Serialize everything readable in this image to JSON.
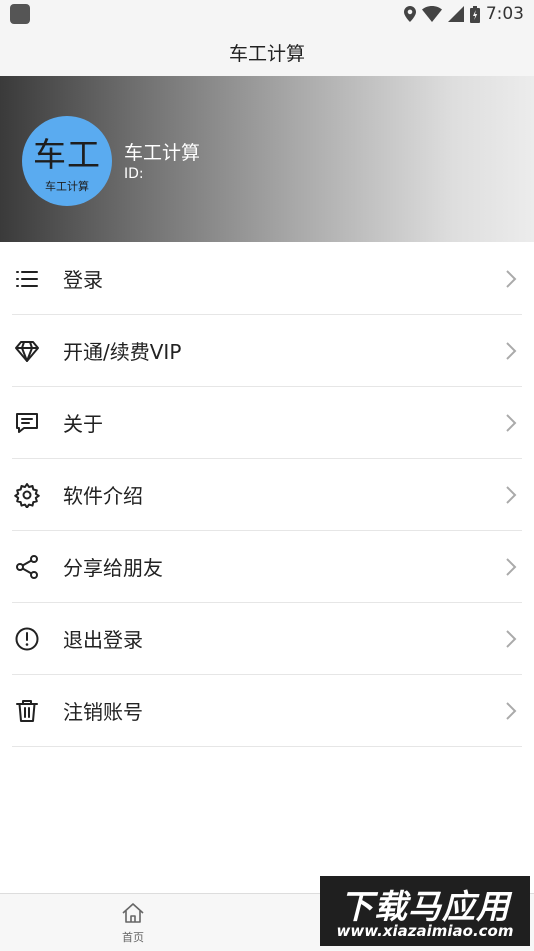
{
  "status_bar": {
    "time": "7:03"
  },
  "header": {
    "title": "车工计算"
  },
  "profile": {
    "avatar_text_large": "车工",
    "avatar_text_small": "车工计算",
    "name": "车工计算",
    "id_label": "ID:"
  },
  "menu": {
    "items": [
      {
        "label": "登录",
        "icon": "list-icon"
      },
      {
        "label": "开通/续费VIP",
        "icon": "diamond-icon"
      },
      {
        "label": "关于",
        "icon": "message-icon"
      },
      {
        "label": "软件介绍",
        "icon": "gear-icon"
      },
      {
        "label": "分享给朋友",
        "icon": "share-icon"
      },
      {
        "label": "退出登录",
        "icon": "alert-circle-icon"
      },
      {
        "label": "注销账号",
        "icon": "trash-icon"
      }
    ]
  },
  "bottom_nav": {
    "home_label": "首页"
  },
  "watermark": {
    "text": "下载马应用",
    "url": "www.xiazaimiao.com"
  }
}
